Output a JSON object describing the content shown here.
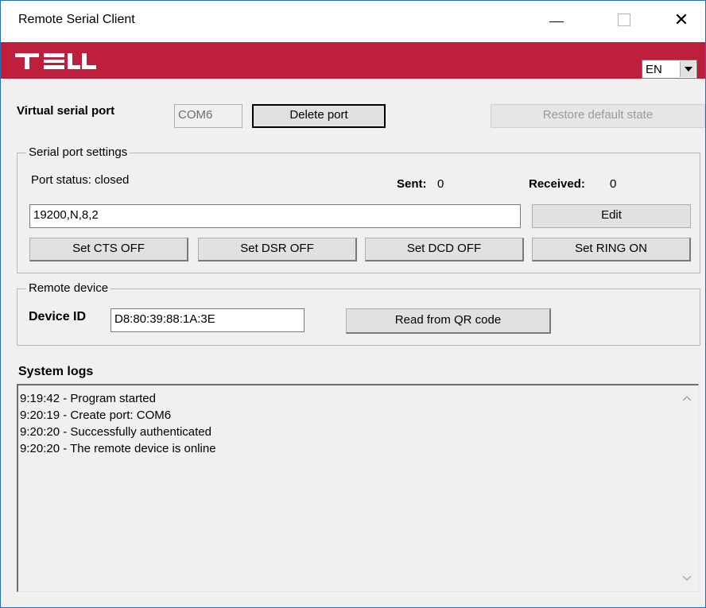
{
  "window": {
    "title": "Remote Serial Client",
    "minimize_glyph": "—",
    "close_glyph": "✕"
  },
  "brand": {
    "logo_text": "TELL",
    "accent_color": "#bd1f3d",
    "language": {
      "selected": "EN"
    }
  },
  "virtual_port": {
    "label": "Virtual serial port",
    "port_value": "COM6",
    "delete_label": "Delete port",
    "restore_label": "Restore default state"
  },
  "serial_settings": {
    "legend": "Serial port settings",
    "status_text": "Port status: closed",
    "sent_label": "Sent:",
    "sent_value": "0",
    "received_label": "Received:",
    "received_value": "0",
    "params_value": "19200,N,8,2",
    "edit_label": "Edit",
    "signal_buttons": [
      "Set CTS OFF",
      "Set DSR OFF",
      "Set DCD OFF",
      "Set RING ON"
    ]
  },
  "remote_device": {
    "legend": "Remote device",
    "device_id_label": "Device ID",
    "device_id_value": "D8:80:39:88:1A:3E",
    "qr_label": "Read from QR code"
  },
  "system_logs": {
    "title": "System logs",
    "lines": [
      "9:19:42 - Program started",
      "9:20:19 - Create port: COM6",
      "9:20:20 - Successfully authenticated",
      "9:20:20 - The remote device is online"
    ],
    "scroll_up_icon": "chevron-up-icon",
    "scroll_down_icon": "chevron-down-icon"
  }
}
